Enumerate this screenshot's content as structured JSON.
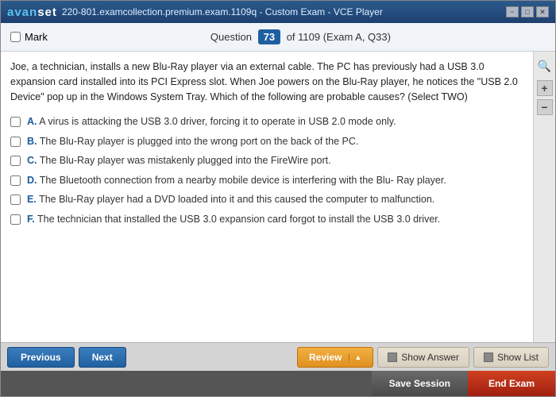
{
  "window": {
    "title": "220-801.examcollection.premium.exam.1109q - Custom Exam - VCE Player",
    "logo_first": "avan",
    "logo_second": "set"
  },
  "controls": {
    "minimize": "−",
    "maximize": "□",
    "close": "✕"
  },
  "question_header": {
    "mark_label": "Mark",
    "question_word": "Question",
    "question_number": "73",
    "of_text": "of 1109 (Exam A, Q33)"
  },
  "question": {
    "body": "Joe, a technician, installs a new Blu-Ray player via an external cable. The PC has previously had a USB 3.0 expansion card installed into its PCI Express slot. When Joe powers on the Blu-Ray player, he notices the \"USB 2.0 Device\" pop up in the Windows System Tray. Which of the following are probable causes? (Select TWO)",
    "options": [
      {
        "id": "A",
        "text": "A virus is attacking the USB 3.0 driver, forcing it to operate in USB 2.0 mode only."
      },
      {
        "id": "B",
        "text": "The Blu-Ray player is plugged into the wrong port on the back of the PC."
      },
      {
        "id": "C",
        "text": "The Blu-Ray player was mistakenly plugged into the FireWire port."
      },
      {
        "id": "D",
        "text": "The Bluetooth connection from a nearby mobile device is interfering with the Blu- Ray player."
      },
      {
        "id": "E",
        "text": "The Blu-Ray player had a DVD loaded into it and this caused the computer to malfunction."
      },
      {
        "id": "F",
        "text": "The technician that installed the USB 3.0 expansion card forgot to install the USB 3.0 driver."
      }
    ]
  },
  "toolbar": {
    "previous_label": "Previous",
    "next_label": "Next",
    "review_label": "Review",
    "show_answer_label": "Show Answer",
    "show_list_label": "Show List"
  },
  "actions": {
    "save_session_label": "Save Session",
    "end_exam_label": "End Exam"
  },
  "zoom": {
    "plus": "+",
    "minus": "−",
    "search": "🔍"
  }
}
